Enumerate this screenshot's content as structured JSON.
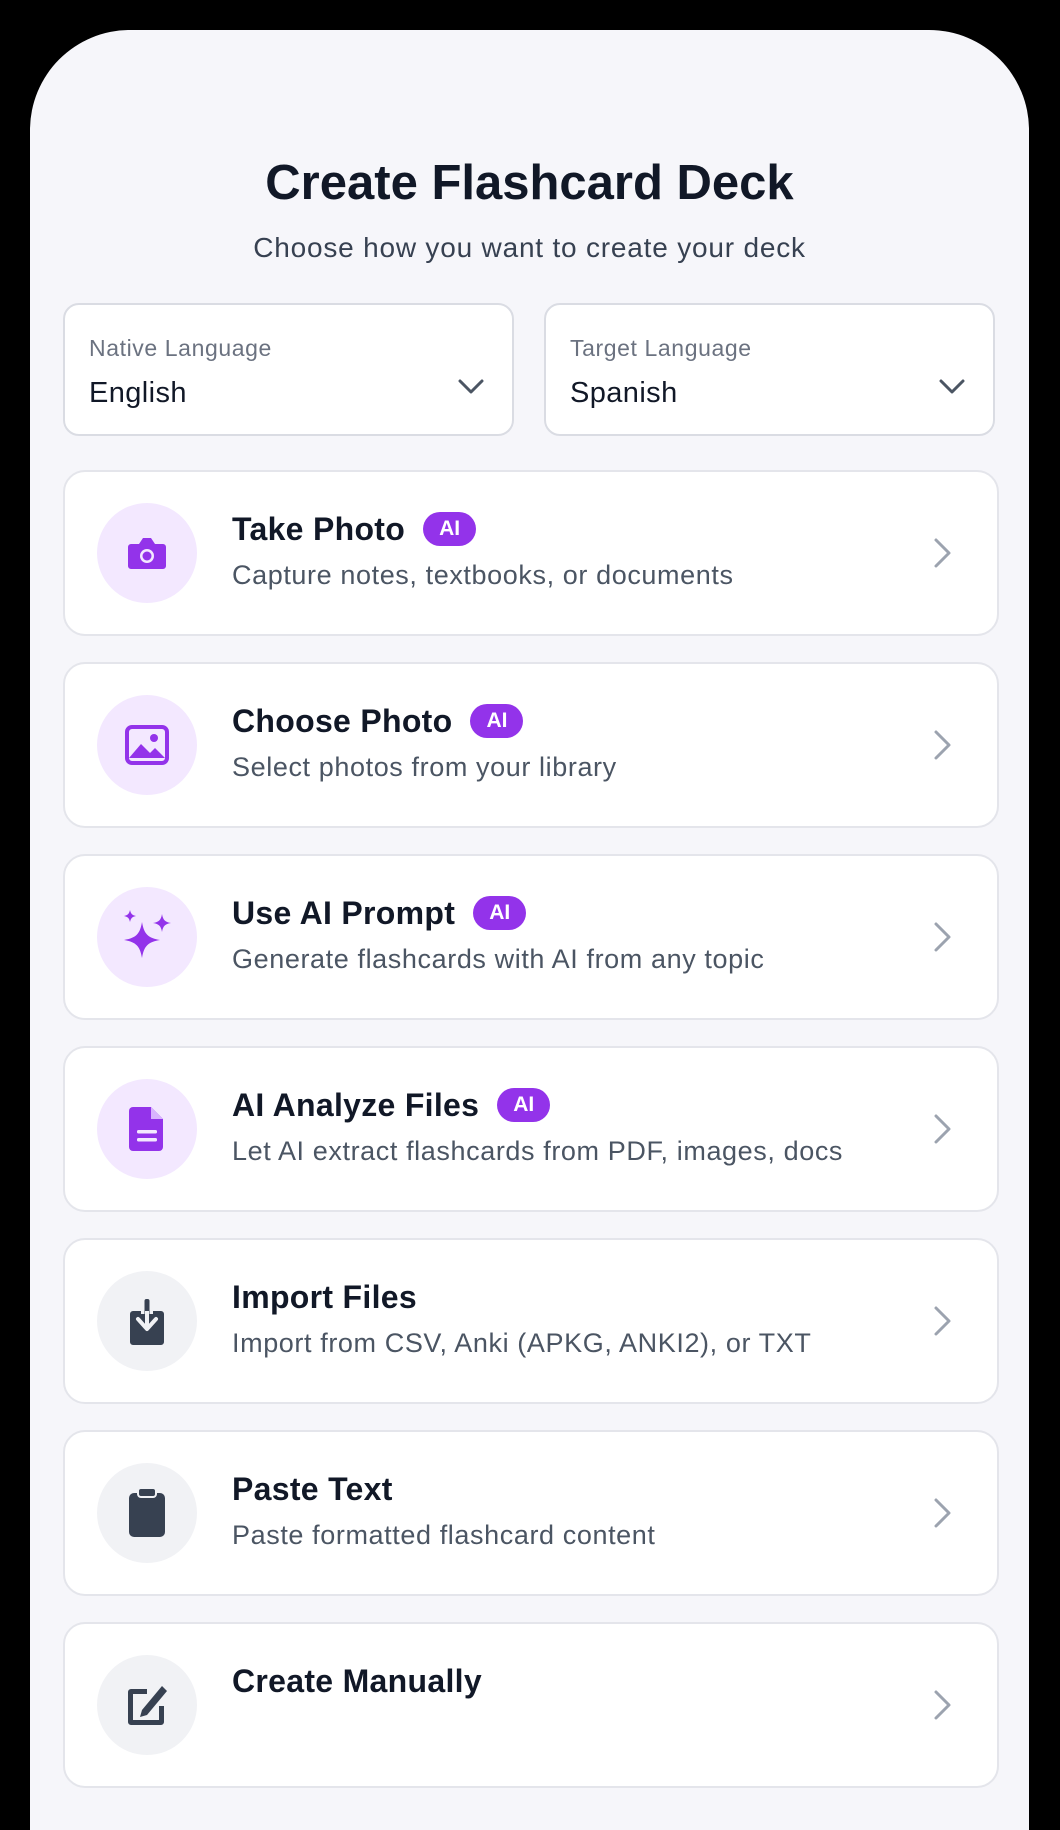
{
  "header": {
    "title": "Create Flashcard Deck",
    "subtitle": "Choose how you want to create your deck"
  },
  "languages": {
    "native": {
      "label": "Native Language",
      "value": "English"
    },
    "target": {
      "label": "Target Language",
      "value": "Spanish"
    }
  },
  "options": [
    {
      "title": "Take Photo",
      "badge": "AI",
      "description": "Capture notes, textbooks, or documents",
      "icon": "camera-icon"
    },
    {
      "title": "Choose Photo",
      "badge": "AI",
      "description": "Select photos from your library",
      "icon": "image-icon"
    },
    {
      "title": "Use AI Prompt",
      "badge": "AI",
      "description": "Generate flashcards with AI from any topic",
      "icon": "sparkles-icon"
    },
    {
      "title": "AI Analyze Files",
      "badge": "AI",
      "description": "Let AI extract flashcards from PDF, images, docs",
      "icon": "document-icon"
    },
    {
      "title": "Import Files",
      "badge": "",
      "description": "Import from CSV, Anki (APKG, ANKI2), or TXT",
      "icon": "download-icon"
    },
    {
      "title": "Paste Text",
      "badge": "",
      "description": "Paste formatted flashcard content",
      "icon": "clipboard-icon"
    },
    {
      "title": "Create Manually",
      "badge": "",
      "description": "",
      "icon": "pencil-icon"
    }
  ],
  "colors": {
    "accent": "#9333EA",
    "accent_light": "#F3E8FF",
    "background": "#F6F6FA",
    "dark_icon": "#374151"
  }
}
